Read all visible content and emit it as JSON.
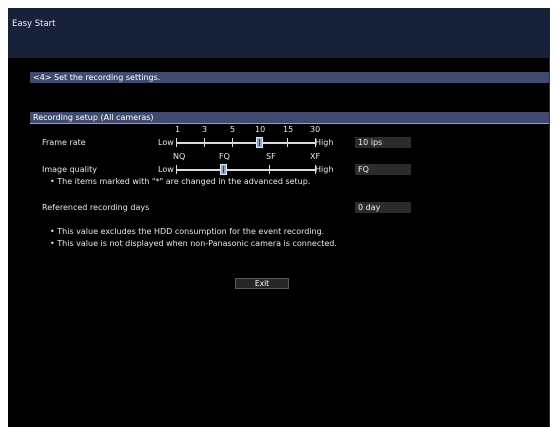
{
  "window": {
    "title": "Easy Start"
  },
  "step": {
    "heading": "<4> Set the recording settings."
  },
  "recording": {
    "section_title": "Recording setup (All cameras)",
    "frame_rate": {
      "label": "Frame rate",
      "scale_labels": [
        "1",
        "3",
        "5",
        "10",
        "15",
        "30"
      ],
      "low_label": "Low",
      "high_label": "High",
      "value": "10 ips",
      "selected_index": 3
    },
    "image_quality": {
      "label": "Image quality",
      "scale_labels": [
        "NQ",
        "FQ",
        "SF",
        "XF"
      ],
      "low_label": "Low",
      "high_label": "High",
      "value": "FQ",
      "selected_index": 1
    },
    "advanced_note": "• The items marked with \"*\" are changed in the advanced setup.",
    "referenced_days": {
      "label": "Referenced recording days",
      "value": "0 day"
    },
    "notes": [
      "• This value excludes the HDD consumption for the event recording.",
      "• This value is not displayed when non-Panasonic camera is connected."
    ]
  },
  "buttons": {
    "exit": "Exit"
  }
}
